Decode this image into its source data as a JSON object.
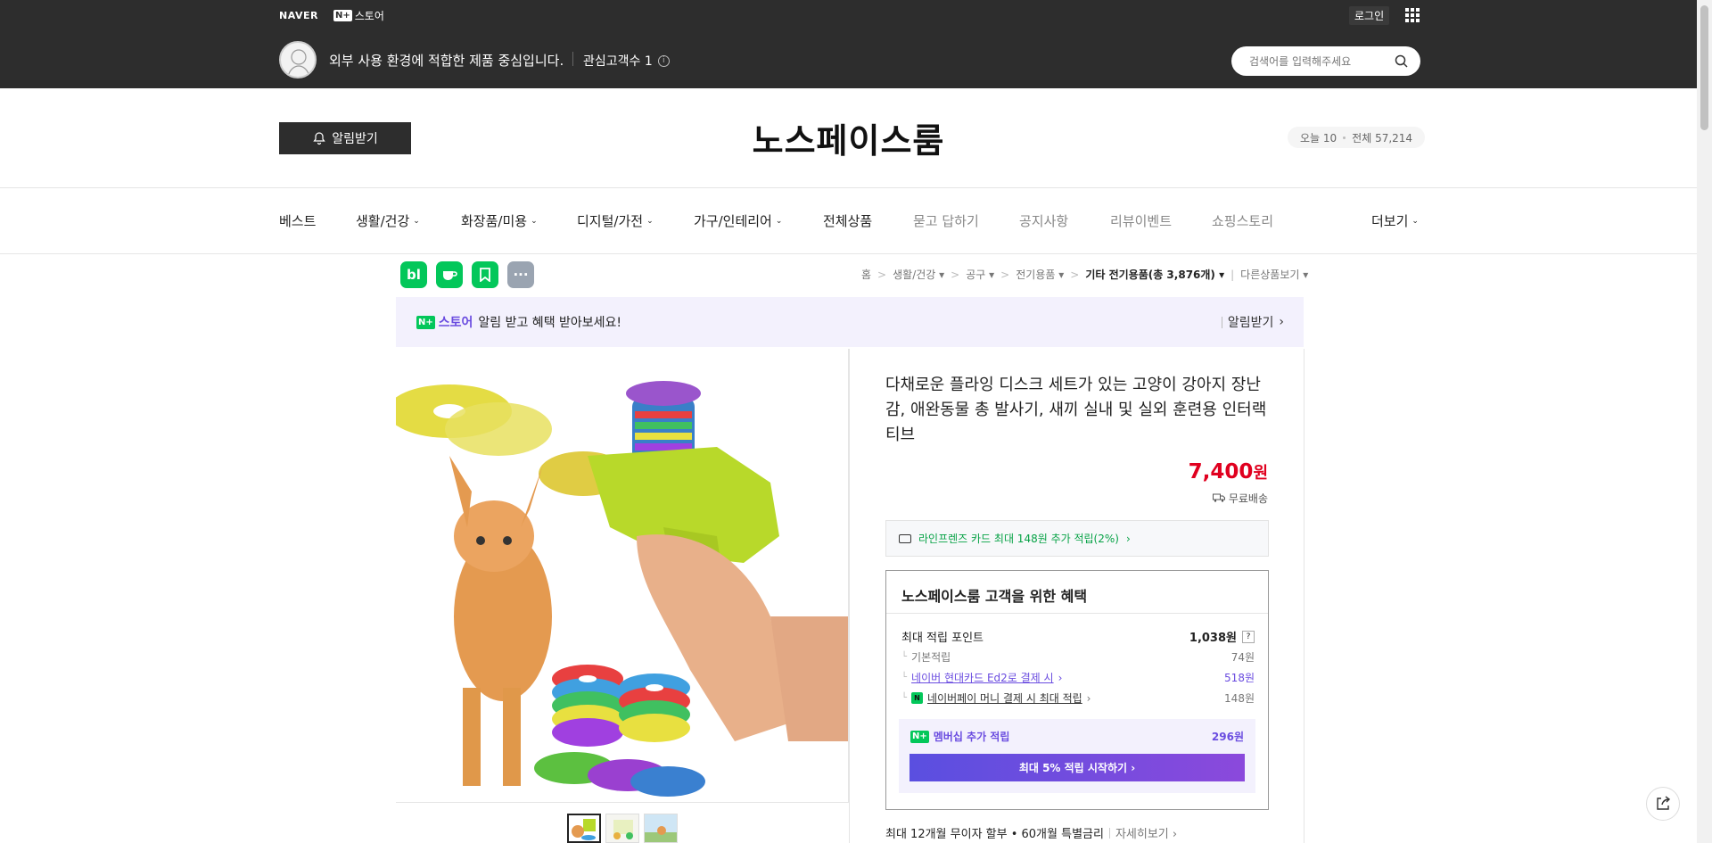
{
  "topbar": {
    "naver": "NAVER",
    "nplus_box": "N+",
    "store_label": "스토어",
    "login": "로그인",
    "store_desc": "외부 사용 환경에 적합한 제품 중심입니다.",
    "favorites": "관심고객수 1",
    "info_icon": "i",
    "search_placeholder": "검색어를 입력해주세요"
  },
  "header": {
    "alarm_button": "알림받기",
    "store_name": "노스페이스룸",
    "today_visits": "오늘 10",
    "total_visits": "전체 57,214"
  },
  "nav": {
    "items": [
      "베스트",
      "생활/건강",
      "화장품/미용",
      "디지털/가전",
      "가구/인테리어",
      "전체상품",
      "묻고 답하기",
      "공지사항",
      "리뷰이벤트",
      "쇼핑스토리"
    ],
    "more": "더보기"
  },
  "share_icons": {
    "blog": "bl",
    "more": "···"
  },
  "breadcrumb": {
    "home": "홈",
    "c1": "생활/건강",
    "c2": "공구",
    "c3": "전기용품",
    "c4": "기타 전기용품",
    "count": "(총 3,876개)",
    "other": "다른상품보기"
  },
  "promo": {
    "tag": "스토어",
    "text": "알림 받고 혜택 받아보세요!",
    "action": "알림받기"
  },
  "product": {
    "title": "다채로운 플라잉 디스크 세트가 있는 고양이 강아지 장난감, 애완동물 총 발사기, 새끼 실내 및 실외 훈련용 인터랙티브",
    "price": "7,400",
    "won": "원",
    "shipping": "무료배송",
    "card_benefit": "라인프렌즈 카드 최대 148원 추가 적립(2%)"
  },
  "benefit": {
    "heading": "노스페이스룸 고객을 위한 혜택",
    "max_points_label": "최대 적립 포인트",
    "max_points": "1,038원",
    "help": "?",
    "basic_label": "기본적립",
    "basic": "74원",
    "hyundai_label": "네이버 현대카드 Ed2로 결제 시",
    "hyundai": "518원",
    "npay_label": "네이버페이 머니 결제 시 최대 적립",
    "npay": "148원",
    "member_label": "멤버십 추가 적립",
    "member": "296원",
    "member_cta": "최대 5% 적립 시작하기"
  },
  "installment": {
    "text": "최대 12개월 무이자 할부 • 60개월 특별금리",
    "more": "자세히보기"
  },
  "colors": {
    "topbar": "#2d2d2d",
    "accent_purple": "#6a4ce0",
    "price_red": "#e0001f",
    "naver_green": "#03c75a"
  }
}
